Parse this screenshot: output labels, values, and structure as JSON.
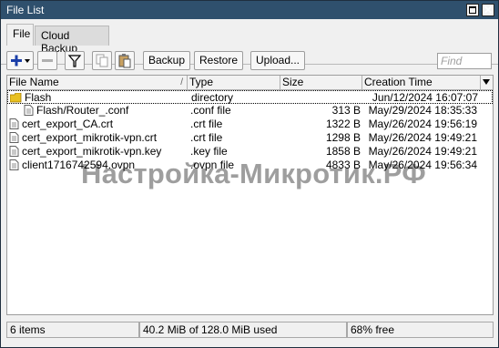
{
  "window": {
    "title": "File List"
  },
  "tabs": [
    {
      "label": "File",
      "active": true
    },
    {
      "label": "Cloud Backup",
      "active": false
    }
  ],
  "toolbar": {
    "add_icon": "plus-icon",
    "remove_icon": "minus-icon",
    "filter_icon": "filter-icon",
    "copy_icon": "copy-icon",
    "paste_icon": "paste-icon",
    "backup_label": "Backup",
    "restore_label": "Restore",
    "upload_label": "Upload...",
    "find_placeholder": "Find"
  },
  "table": {
    "columns": {
      "name": "File Name",
      "type": "Type",
      "size": "Size",
      "ctime": "Creation Time"
    },
    "sort_mark": "/",
    "rows": [
      {
        "name": "Flash",
        "type": "directory",
        "size": "",
        "ctime": "Jun/12/2024 16:07:07",
        "icon": "folder-icon",
        "indent": false
      },
      {
        "name": "Flash/Router_.conf",
        "type": ".conf file",
        "size": "313 B",
        "ctime": "May/29/2024 18:35:33",
        "icon": "file-icon",
        "indent": true
      },
      {
        "name": "cert_export_CA.crt",
        "type": ".crt file",
        "size": "1322 B",
        "ctime": "May/26/2024 19:56:19",
        "icon": "file-icon",
        "indent": false
      },
      {
        "name": "cert_export_mikrotik-vpn.crt",
        "type": ".crt file",
        "size": "1298 B",
        "ctime": "May/26/2024 19:49:21",
        "icon": "file-icon",
        "indent": false
      },
      {
        "name": "cert_export_mikrotik-vpn.key",
        "type": ".key file",
        "size": "1858 B",
        "ctime": "May/26/2024 19:49:21",
        "icon": "file-icon",
        "indent": false
      },
      {
        "name": "client1716742594.ovpn",
        "type": ".ovpn file",
        "size": "4833 B",
        "ctime": "May/26/2024 19:56:34",
        "icon": "file-icon",
        "indent": false
      }
    ]
  },
  "watermark": "Настройка-Микротик.РФ",
  "status": {
    "items": "6 items",
    "used": "40.2 MiB of 128.0 MiB used",
    "free": "68% free"
  },
  "colors": {
    "titlebar": "#2f506d",
    "add_icon": "#1b3fa8",
    "folder": "#e8c020"
  }
}
